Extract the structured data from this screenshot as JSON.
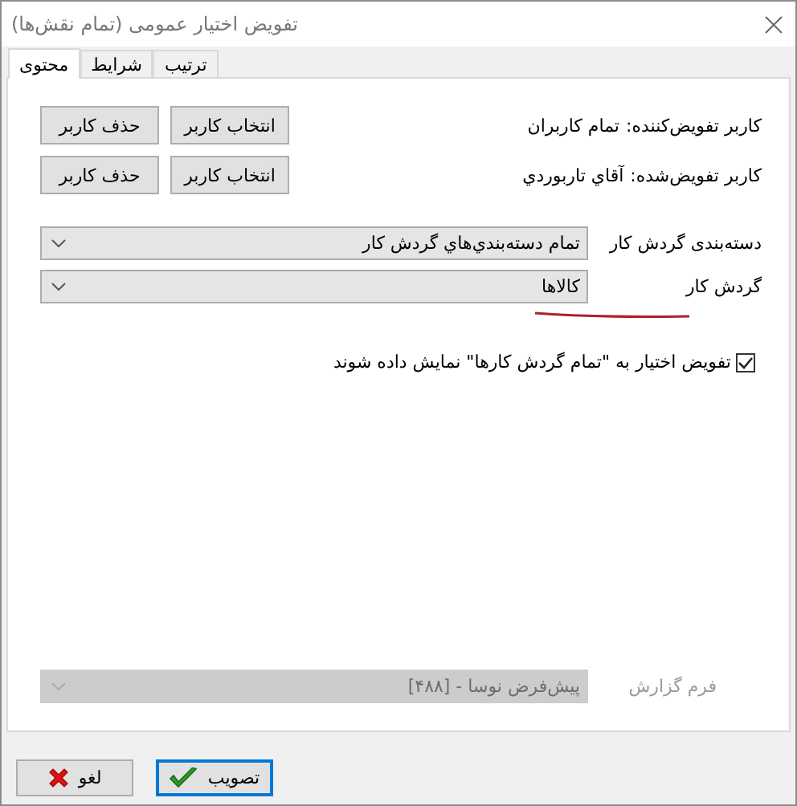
{
  "window": {
    "title": "تفویض اختیار عمومی (تمام نقش‌ها)"
  },
  "tabs": [
    {
      "label": "ترتیب",
      "selected": false
    },
    {
      "label": "شرایط",
      "selected": false
    },
    {
      "label": "محتوی",
      "selected": true
    }
  ],
  "users": [
    {
      "label": "کاربر تفویض‌کننده:",
      "value": "تمام کاربران",
      "buttons": [
        "انتخاب کاربر",
        "حذف کاربر"
      ]
    },
    {
      "label": "کاربر تفویض‌شده:",
      "value": "آقاي تاربوردي",
      "buttons": [
        "انتخاب کاربر",
        "حذف کاربر"
      ]
    }
  ],
  "combos": [
    {
      "label": "دسته‌بندی گردش کار",
      "value": "تمام دسته‌بندي‌هاي گردش کار",
      "disabled": false
    },
    {
      "label": "گردش کار",
      "value": "کالاها",
      "disabled": false
    }
  ],
  "checkbox": {
    "label": "تفویض اختیار به \"تمام گردش کارها\" نمایش داده شوند",
    "checked": true
  },
  "report": {
    "label": "فرم گزارش",
    "value": "پیش‌فرض نوسا - [۴۸۸]",
    "disabled": true
  },
  "buttons": [
    {
      "label": "تصویب",
      "kind": "ok",
      "focused": true
    },
    {
      "label": "لغو",
      "kind": "cancel",
      "focused": false
    }
  ]
}
